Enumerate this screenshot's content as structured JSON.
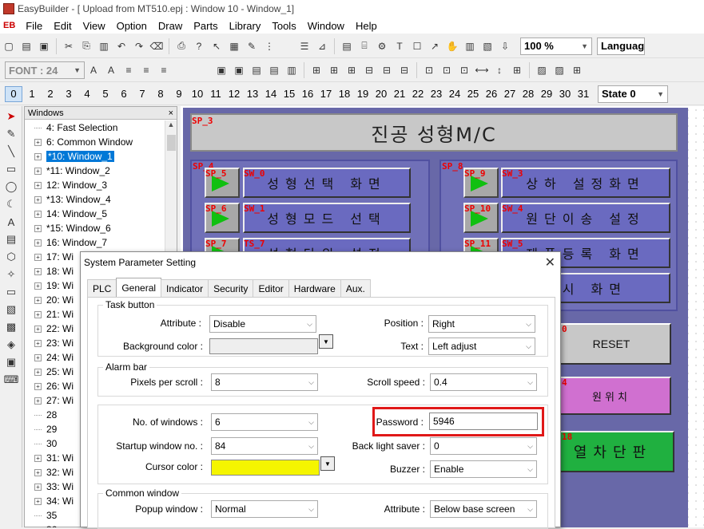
{
  "titlebar": {
    "text": "EasyBuilder - [   Upload from MT510.epj  :  Window 10  -  Window_1]"
  },
  "menu": {
    "logo": "EB",
    "items": [
      "File",
      "Edit",
      "View",
      "Option",
      "Draw",
      "Parts",
      "Library",
      "Tools",
      "Window",
      "Help"
    ]
  },
  "toolbar": {
    "zoom": "100 %",
    "language": "Language"
  },
  "fontbar": {
    "font": "FONT : 24"
  },
  "windowbar": {
    "numbers": [
      "0",
      "1",
      "2",
      "3",
      "4",
      "5",
      "6",
      "7",
      "8",
      "9",
      "10",
      "11",
      "12",
      "13",
      "14",
      "15",
      "16",
      "17",
      "18",
      "19",
      "20",
      "21",
      "22",
      "23",
      "24",
      "25",
      "26",
      "27",
      "28",
      "29",
      "30",
      "31"
    ],
    "selected": "0",
    "state": "State  0"
  },
  "windows_panel": {
    "title": "Windows",
    "close": "×",
    "items": [
      {
        "exp": "",
        "label": "4: Fast Selection"
      },
      {
        "exp": "+",
        "label": "6: Common Window"
      },
      {
        "exp": "+",
        "label": "*10: Window_1",
        "selected": true
      },
      {
        "exp": "+",
        "label": "*11: Window_2"
      },
      {
        "exp": "+",
        "label": "12: Window_3"
      },
      {
        "exp": "+",
        "label": "*13: Window_4"
      },
      {
        "exp": "+",
        "label": "14: Window_5"
      },
      {
        "exp": "+",
        "label": "*15: Window_6"
      },
      {
        "exp": "+",
        "label": "16: Window_7"
      },
      {
        "exp": "+",
        "label": "17: Wi"
      },
      {
        "exp": "+",
        "label": "18: Wi"
      },
      {
        "exp": "+",
        "label": "19: Wi"
      },
      {
        "exp": "+",
        "label": "20: Wi"
      },
      {
        "exp": "+",
        "label": "21: Wi"
      },
      {
        "exp": "+",
        "label": "22: Wi"
      },
      {
        "exp": "+",
        "label": "23: Wi"
      },
      {
        "exp": "+",
        "label": "24: Wi"
      },
      {
        "exp": "+",
        "label": "25: Wi"
      },
      {
        "exp": "+",
        "label": "26: Wi"
      },
      {
        "exp": "+",
        "label": "27: Wi"
      },
      {
        "exp": "",
        "label": "28"
      },
      {
        "exp": "",
        "label": "29"
      },
      {
        "exp": "",
        "label": "30"
      },
      {
        "exp": "+",
        "label": "31: Wi"
      },
      {
        "exp": "+",
        "label": "32: Wi"
      },
      {
        "exp": "+",
        "label": "33: Wi"
      },
      {
        "exp": "+",
        "label": "34: Wi"
      },
      {
        "exp": "",
        "label": "35"
      },
      {
        "exp": "",
        "label": "36"
      }
    ]
  },
  "screen": {
    "title_label": "SP_3",
    "title": "진공 성형M/C",
    "left_group_label": "SP_4",
    "right_group_label": "SP_8",
    "left_buttons": [
      {
        "sp": "SP_5",
        "sw": "SW_0",
        "text": "성형선택 화면"
      },
      {
        "sp": "SP_6",
        "sw": "SW_1",
        "text": "성형모드 선택"
      },
      {
        "sp": "SP_7",
        "sw": "TS_7",
        "text": "성형단위 설정"
      }
    ],
    "right_buttons": [
      {
        "sp": "SP_9",
        "sw": "SW_3",
        "text": "상하 설정화면"
      },
      {
        "sp": "SP_10",
        "sw": "SW_4",
        "text": "원단이송 설정"
      },
      {
        "sp": "SP_11",
        "sw": "SW_5",
        "text": "제품등록 화면"
      },
      {
        "sp": "",
        "sw": "",
        "text": "표시 화면"
      }
    ],
    "reset_label": "0",
    "reset": "RESET",
    "home_label": "4",
    "home": "원위치",
    "panel_label": "18",
    "panel": "열차단판"
  },
  "dialog": {
    "title": "System Parameter Setting",
    "close": "✕",
    "tabs": [
      "PLC",
      "General",
      "Indicator",
      "Security",
      "Editor",
      "Hardware",
      "Aux."
    ],
    "active_tab": "General",
    "task_button": {
      "legend": "Task button",
      "attribute_label": "Attribute :",
      "attribute": "Disable",
      "bg_color_label": "Background color :",
      "position_label": "Position :",
      "position": "Right",
      "text_label": "Text :",
      "text": "Left adjust"
    },
    "alarm_bar": {
      "legend": "Alarm bar",
      "pixels_label": "Pixels per scroll :",
      "pixels": "8",
      "speed_label": "Scroll speed :",
      "speed": "0.4"
    },
    "misc": {
      "windows_label": "No. of windows :",
      "windows": "6",
      "password_label": "Password :",
      "password": "5946",
      "startup_label": "Startup window no. :",
      "startup": "84",
      "backlight_label": "Back light saver :",
      "backlight": "0",
      "cursor_label": "Cursor color :",
      "buzzer_label": "Buzzer :",
      "buzzer": "Enable"
    },
    "common_window": {
      "legend": "Common window",
      "popup_label": "Popup window :",
      "popup": "Normal",
      "attribute_label": "Attribute :",
      "attribute": "Below base screen"
    }
  },
  "colors": {
    "screen_bg": "#6868a8",
    "cursor_color": "#f5f500",
    "highlight": "#e01818",
    "selection": "#0078d7"
  }
}
